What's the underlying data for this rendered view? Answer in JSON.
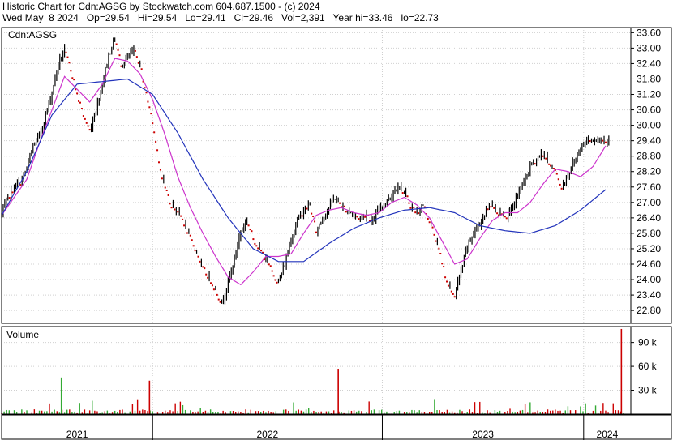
{
  "header": {
    "line1": "Historic Chart for Cdn:AGSG by Stockwatch.com 604.687.1500 - (c) 2024",
    "line2": "Wed May  8 2024   Op=29.54   Hi=29.54   Lo=29.41   Cl=29.46   Vol=2,391   Year hi=33.46   lo=22.73"
  },
  "colors": {
    "price": "#000000",
    "down_dot": "#cc0000",
    "ma_short": "#cc33cc",
    "ma_long": "#2233bb",
    "vol_up": "#33aa33",
    "vol_down": "#cc0000",
    "grid": "#d0d0d0"
  },
  "chart_data": [
    {
      "type": "line",
      "title": "Cdn:AGSG",
      "x_axis_labels": [
        "2021",
        "2022",
        "2023",
        "2024"
      ],
      "ylim": [
        22.3,
        33.8
      ],
      "y_ticks": [
        "33.60",
        "33.00",
        "32.40",
        "31.80",
        "31.20",
        "30.60",
        "30.00",
        "29.40",
        "28.80",
        "28.20",
        "27.60",
        "27.00",
        "26.40",
        "25.80",
        "25.20",
        "24.60",
        "24.00",
        "23.40",
        "22.80"
      ],
      "grid": true,
      "series": [
        {
          "role": "price",
          "t": [
            0,
            2,
            4,
            6,
            8,
            10,
            12,
            14,
            16,
            18,
            20,
            22,
            24,
            26,
            28,
            30,
            32,
            34,
            36,
            38,
            40,
            42,
            44,
            46,
            48,
            50,
            52,
            54,
            56,
            58,
            60,
            62,
            64,
            66,
            68,
            70,
            72,
            74,
            76,
            78,
            80,
            82,
            84,
            86,
            88,
            90,
            92,
            94,
            96,
            98,
            100,
            102,
            104,
            106,
            108,
            110,
            112,
            114,
            116,
            118,
            120,
            122,
            124,
            126,
            128,
            130,
            132,
            134,
            136,
            138,
            140,
            142,
            144,
            146,
            148,
            150,
            152,
            154,
            156,
            158,
            160,
            162,
            164,
            166,
            168,
            170,
            172,
            174,
            176,
            178,
            180,
            182,
            184,
            186,
            188,
            190,
            192,
            194,
            196,
            198,
            200
          ],
          "values": [
            26.5,
            27.2,
            27.6,
            27.8,
            28.3,
            29.2,
            29.6,
            30.4,
            31.3,
            32.4,
            32.9,
            32.2,
            31.2,
            30.4,
            29.8,
            30.6,
            31.6,
            32.7,
            33.4,
            32.4,
            32.6,
            32.9,
            32.4,
            31.2,
            30.2,
            28.5,
            27.6,
            26.9,
            26.7,
            26.2,
            25.6,
            25.1,
            24.4,
            24.1,
            23.6,
            23.1,
            23.9,
            24.8,
            25.9,
            26.3,
            25.6,
            25.2,
            24.8,
            24.3,
            23.9,
            24.6,
            25.6,
            26.3,
            26.7,
            26.9,
            25.9,
            26.4,
            26.8,
            27.2,
            26.9,
            26.7,
            26.5,
            26.4,
            26.6,
            26.2,
            26.8,
            27.0,
            27.3,
            27.7,
            27.4,
            26.9,
            26.6,
            26.9,
            26.3,
            25.6,
            24.7,
            23.7,
            23.4,
            24.3,
            25.3,
            25.8,
            26.2,
            26.7,
            27.0,
            26.6,
            26.4,
            26.7,
            27.3,
            27.8,
            28.4,
            28.7,
            28.9,
            28.6,
            28.2,
            27.6,
            28.1,
            28.6,
            29.1,
            29.46,
            29.46,
            29.46,
            29.46,
            29.46,
            29.46,
            29.46,
            29.46
          ]
        },
        {
          "role": "ma_short",
          "t": [
            0,
            4,
            8,
            12,
            16,
            20,
            24,
            28,
            32,
            36,
            40,
            44,
            48,
            52,
            56,
            60,
            64,
            68,
            72,
            76,
            80,
            84,
            88,
            92,
            96,
            100,
            104,
            108,
            112,
            116,
            120,
            124,
            128,
            132,
            136,
            140,
            144,
            148,
            152,
            156,
            160,
            164,
            168,
            172,
            176,
            180,
            184,
            188,
            192
          ],
          "values": [
            26.5,
            27.2,
            27.9,
            29.3,
            30.6,
            31.9,
            31.4,
            30.9,
            31.6,
            32.6,
            32.5,
            32.0,
            31.0,
            29.6,
            28.0,
            26.8,
            25.8,
            24.9,
            24.1,
            23.8,
            24.3,
            24.9,
            24.9,
            25.0,
            25.8,
            26.5,
            26.7,
            26.8,
            26.6,
            26.5,
            26.6,
            27.0,
            27.2,
            26.9,
            26.4,
            25.5,
            24.6,
            24.8,
            25.6,
            26.3,
            26.6,
            26.6,
            27.0,
            27.7,
            28.3,
            28.2,
            28.0,
            28.4,
            29.2
          ]
        },
        {
          "role": "ma_long",
          "t": [
            0,
            8,
            16,
            24,
            32,
            40,
            48,
            56,
            64,
            72,
            80,
            88,
            96,
            104,
            112,
            120,
            128,
            136,
            144,
            152,
            160,
            168,
            176,
            184,
            192
          ],
          "values": [
            26.5,
            28.2,
            30.4,
            31.6,
            31.7,
            31.8,
            31.2,
            29.7,
            27.9,
            26.4,
            25.2,
            24.7,
            24.7,
            25.4,
            26.0,
            26.4,
            26.7,
            26.8,
            26.6,
            26.1,
            25.9,
            25.8,
            26.1,
            26.7,
            27.5
          ]
        }
      ]
    },
    {
      "type": "bar",
      "title": "Volume",
      "y_ticks": [
        "90 k",
        "60 k",
        "30 k"
      ],
      "ylim": [
        0,
        110
      ],
      "spikes": [
        {
          "t": 19,
          "value": 46,
          "dir": "up"
        },
        {
          "t": 47,
          "value": 42,
          "dir": "down"
        },
        {
          "t": 107,
          "value": 57,
          "dir": "down"
        },
        {
          "t": 197,
          "value": 107,
          "dir": "down"
        }
      ]
    }
  ]
}
